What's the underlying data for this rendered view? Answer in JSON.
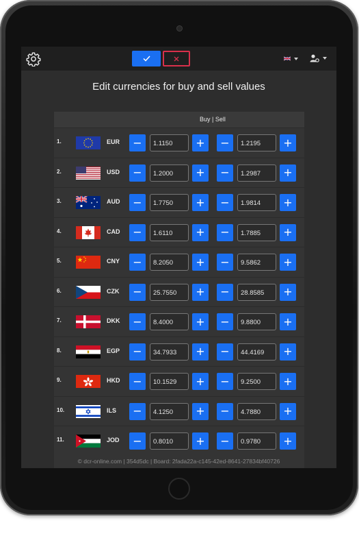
{
  "header": {
    "confirm_icon": "checkmark-icon",
    "cancel_icon": "close-icon",
    "language": "en-GB",
    "settings_icon": "gear-icon",
    "user_icon": "user-settings-icon"
  },
  "title": "Edit currencies for buy and sell values",
  "columns": {
    "buy_sell": "Buy | Sell"
  },
  "rows": [
    {
      "index": "1.",
      "code": "EUR",
      "buy": "1.1150",
      "sell": "1.2195"
    },
    {
      "index": "2.",
      "code": "USD",
      "buy": "1.2000",
      "sell": "1.2987"
    },
    {
      "index": "3.",
      "code": "AUD",
      "buy": "1.7750",
      "sell": "1.9814"
    },
    {
      "index": "4.",
      "code": "CAD",
      "buy": "1.6110",
      "sell": "1.7885"
    },
    {
      "index": "5.",
      "code": "CNY",
      "buy": "8.2050",
      "sell": "9.5862"
    },
    {
      "index": "6.",
      "code": "CZK",
      "buy": "25.7550",
      "sell": "28.8585"
    },
    {
      "index": "7.",
      "code": "DKK",
      "buy": "8.4000",
      "sell": "9.8800"
    },
    {
      "index": "8.",
      "code": "EGP",
      "buy": "34.7933",
      "sell": "44.4169"
    },
    {
      "index": "9.",
      "code": "HKD",
      "buy": "10.1529",
      "sell": "9.2500"
    },
    {
      "index": "10.",
      "code": "ILS",
      "buy": "4.1250",
      "sell": "4.7880"
    },
    {
      "index": "11.",
      "code": "JOD",
      "buy": "0.8010",
      "sell": "0.9780"
    }
  ],
  "controls": {
    "minus": "−",
    "plus": "+"
  },
  "footer": "© dcr-online.com | 354d5dc | Board: 2fada22a-c145-42ed-8641-27834bf40726",
  "colors": {
    "accent": "#1a6ff2",
    "cancel": "#d9304b",
    "background": "#2d2d2d"
  }
}
